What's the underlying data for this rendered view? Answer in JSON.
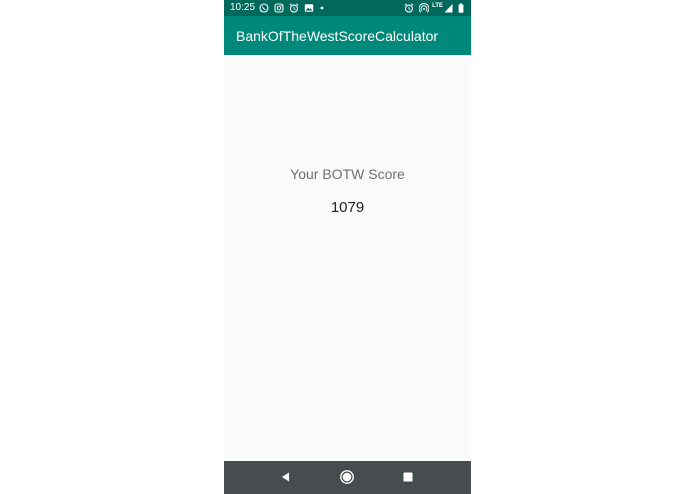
{
  "status_bar": {
    "time": "10:25",
    "network_label": "LTE",
    "left_icons": [
      "whatsapp-icon",
      "instagram-icon",
      "alarm-icon",
      "gallery-icon",
      "dot-icon"
    ],
    "right_icons": [
      "alarm-icon",
      "hotspot-icon",
      "signal-icon",
      "battery-icon"
    ]
  },
  "app_bar": {
    "title": "BankOfTheWestScoreCalculator",
    "color": "#00897b",
    "status_color": "#00695c"
  },
  "main": {
    "score_label": "Your BOTW Score",
    "score_value": "1079"
  },
  "nav_bar": {
    "buttons": [
      "back-icon",
      "home-icon",
      "recents-icon"
    ],
    "color": "#474c4e"
  }
}
